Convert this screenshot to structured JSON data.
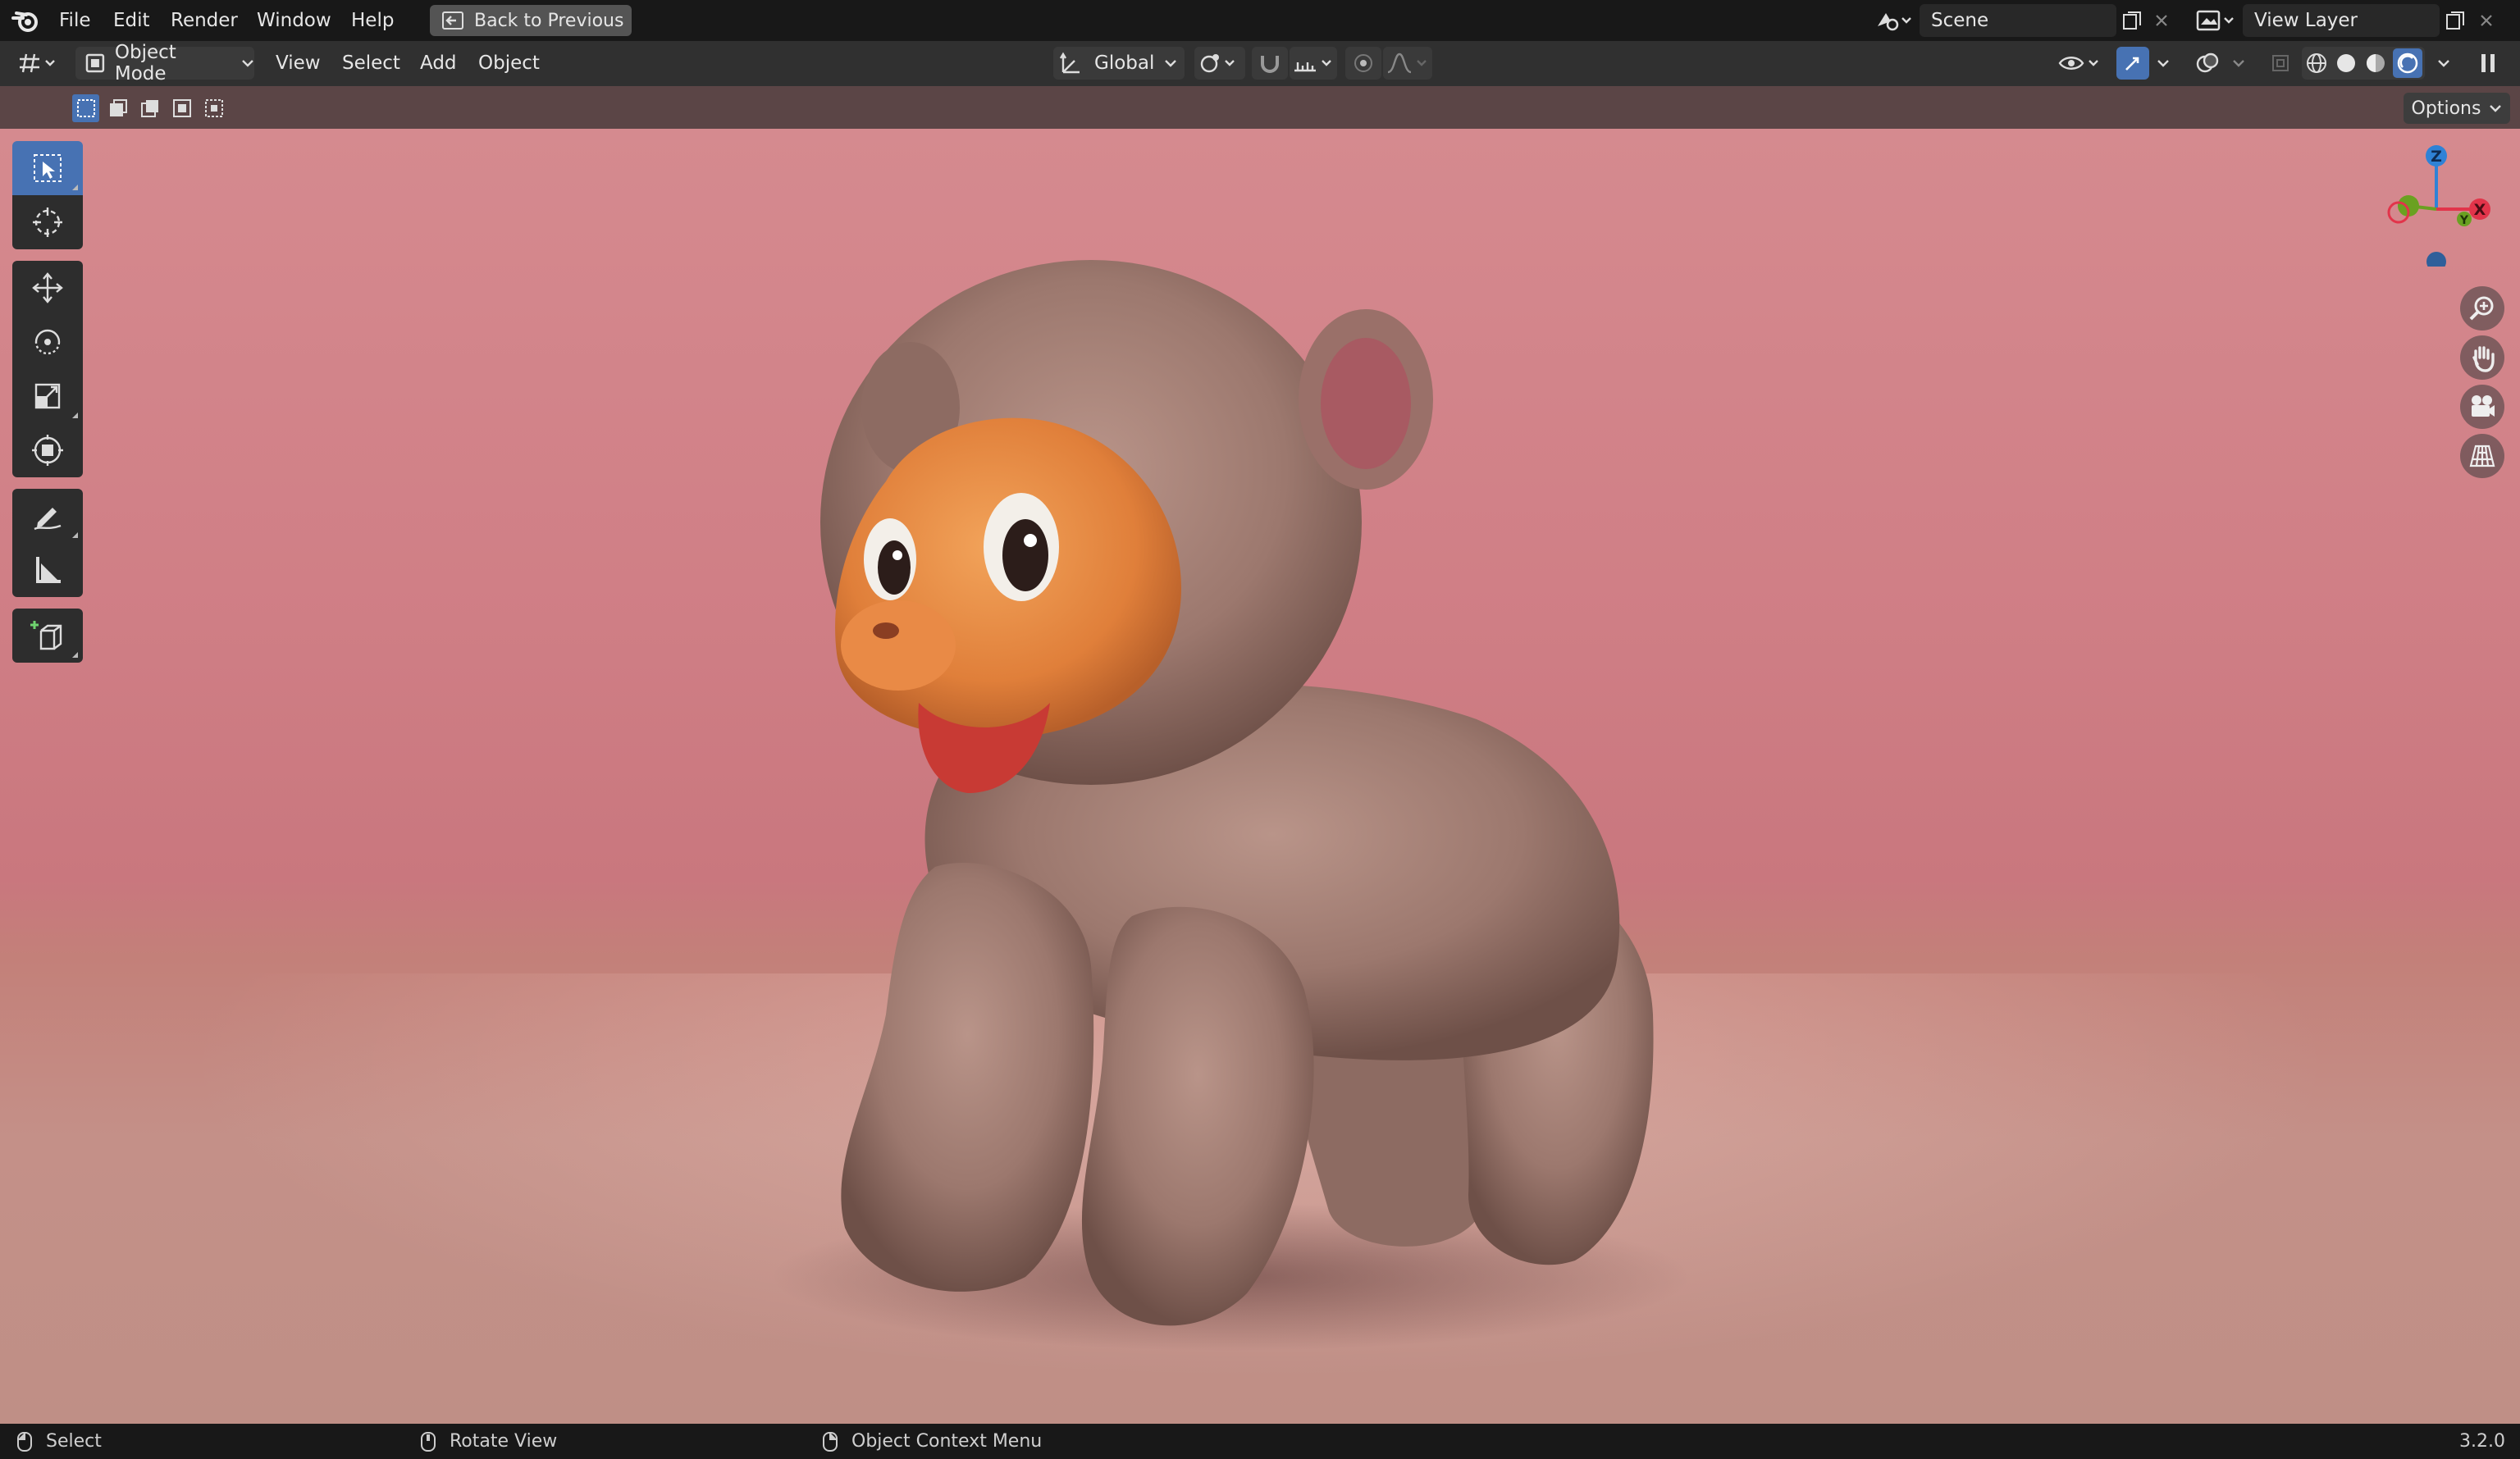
{
  "topbar": {
    "menu": [
      "File",
      "Edit",
      "Render",
      "Window",
      "Help"
    ],
    "back_button": "Back to Previous",
    "scene_name": "Scene",
    "view_layer_name": "View Layer"
  },
  "header": {
    "mode": "Object Mode",
    "menus": [
      "View",
      "Select",
      "Add",
      "Object"
    ],
    "orientation": "Global"
  },
  "toolstrip": {
    "options_label": "Options"
  },
  "viewport": {
    "gizmo_axes": [
      "Z",
      "X",
      "Y"
    ],
    "tools": [
      "select-box",
      "cursor",
      "move",
      "rotate",
      "scale",
      "transform",
      "annotate",
      "measure",
      "add-cube"
    ],
    "active_tool": "select-box",
    "nav_buttons": [
      "zoom",
      "pan",
      "camera",
      "orthographic"
    ]
  },
  "statusbar": {
    "select": "Select",
    "rotate_view": "Rotate View",
    "context_menu": "Object Context Menu",
    "version": "3.2.0"
  },
  "colors": {
    "active_blue": "#4772b3",
    "axis_x": "#e2344a",
    "axis_y": "#6aa121",
    "axis_z": "#2f82d6"
  }
}
